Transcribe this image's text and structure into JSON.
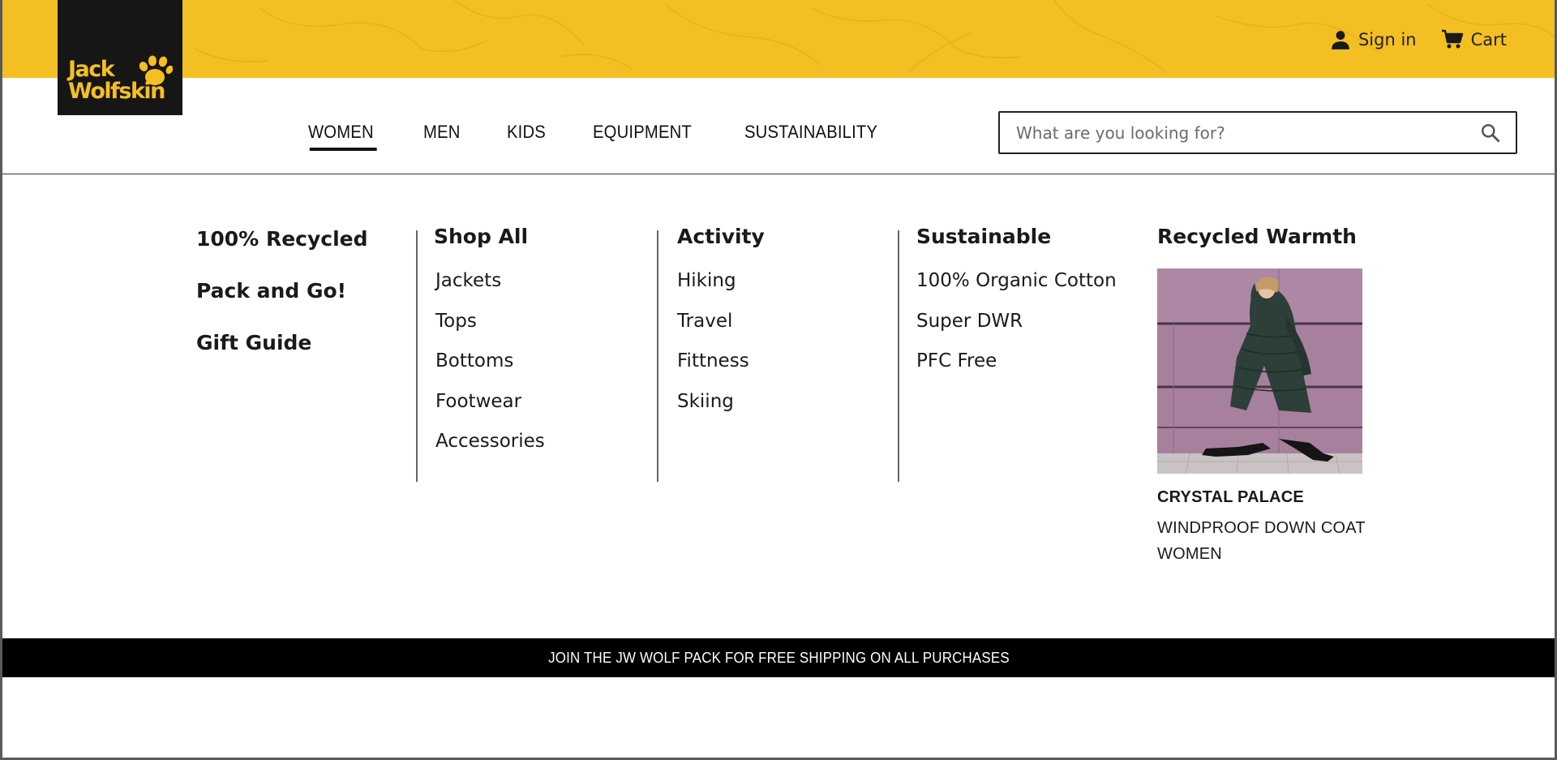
{
  "brand": {
    "logo_text_line1": "Jack",
    "logo_text_line2": "Wolfskin",
    "logo_color": "#f4bf23"
  },
  "header": {
    "sign_in_label": "Sign in",
    "sign_in_icon": "user-icon",
    "cart_label": "Cart",
    "cart_icon": "cart-icon",
    "bar_color": "#f4bf23"
  },
  "nav": {
    "items": [
      {
        "label": "WOMEN",
        "active": true
      },
      {
        "label": "MEN",
        "active": false
      },
      {
        "label": "KIDS",
        "active": false
      },
      {
        "label": "EQUIPMENT",
        "active": false
      },
      {
        "label": "SUSTAINABILITY",
        "active": false
      }
    ]
  },
  "search": {
    "placeholder": "What are you looking for?",
    "value": "",
    "icon": "search-icon"
  },
  "menu": {
    "featured": [
      "100% Recycled",
      "Pack and Go!",
      "Gift Guide"
    ],
    "columns": [
      {
        "heading": "Shop All",
        "links": [
          "Jackets",
          "Tops",
          "Bottoms",
          "Footwear",
          "Accessories"
        ]
      },
      {
        "heading": "Activity",
        "links": [
          "Hiking",
          "Travel",
          "Fittness",
          "Skiing"
        ]
      },
      {
        "heading": "Sustainable",
        "links": [
          "100% Organic Cotton",
          "Super DWR",
          "PFC Free"
        ]
      }
    ],
    "promo": {
      "heading": "Recycled Warmth",
      "product_name": "CRYSTAL PALACE",
      "product_desc": "WINDPROOF DOWN COAT WOMEN"
    }
  },
  "banner": {
    "text": "JOIN THE JW WOLF PACK FOR FREE SHIPPING ON ALL PURCHASES"
  }
}
